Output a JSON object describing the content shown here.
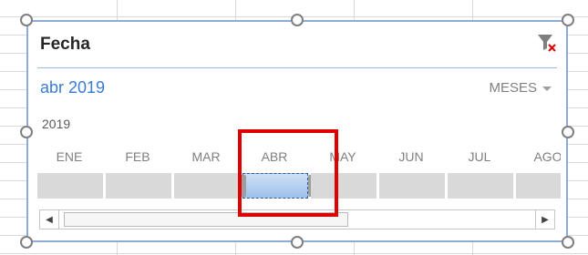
{
  "slicer": {
    "title": "Fecha",
    "selected_range": "abr 2019",
    "time_level": "MESES",
    "year": "2019",
    "months": [
      {
        "label": "ENE",
        "selected": false
      },
      {
        "label": "FEB",
        "selected": false
      },
      {
        "label": "MAR",
        "selected": false
      },
      {
        "label": "ABR",
        "selected": true
      },
      {
        "label": "MAY",
        "selected": false
      },
      {
        "label": "JUN",
        "selected": false
      },
      {
        "label": "JUL",
        "selected": false
      },
      {
        "label": "AGO",
        "selected": false
      }
    ],
    "filter_icon": "clear-filter-icon"
  },
  "colors": {
    "accent": "#3a7bd5",
    "border": "#8eaadb",
    "highlight": "#e00000",
    "bar": "#d9d9d9"
  }
}
